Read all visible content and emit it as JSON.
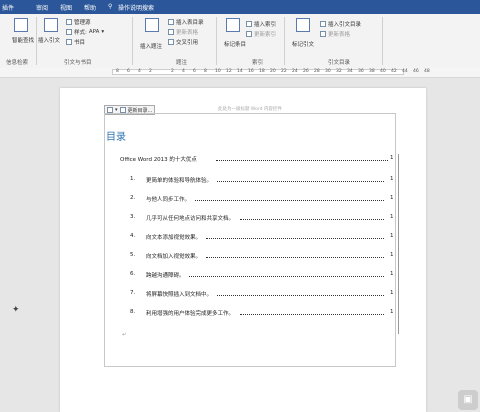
{
  "tabs": [
    "插件",
    "审阅",
    "视图",
    "帮助",
    "操作说明搜索"
  ],
  "ribbon": {
    "research": {
      "button": "智能查找",
      "label": "信息检索"
    },
    "citations": {
      "insert_citation": "插入引文",
      "manage_sources": "管理源",
      "style_label": "样式:",
      "style_value": "APA",
      "bibliography": "书目",
      "label": "引文与书目"
    },
    "captions": {
      "insert_caption": "插入题注",
      "insert_table_of_figures": "插入表目录",
      "update_table": "更新表格",
      "cross_reference": "交叉引用",
      "label": "题注"
    },
    "index": {
      "mark_entry": "标记条目",
      "insert_index": "插入索引",
      "update_index": "更新索引",
      "label": "索引"
    },
    "authorities": {
      "mark_citation": "标记引文",
      "insert_toa": "插入引文目录",
      "update_table": "更新表格",
      "label": "引文目录"
    }
  },
  "ruler_numbers": [
    "8",
    "6",
    "4",
    "2",
    "",
    "2",
    "4",
    "6",
    "8",
    "10",
    "12",
    "14",
    "16",
    "18",
    "20",
    "22",
    "24",
    "26",
    "28",
    "30",
    "32",
    "34",
    "36",
    "38",
    "40",
    "42",
    "44",
    "46",
    "48"
  ],
  "document": {
    "cc_tab_label": "更新目录...",
    "header_note": "此处为一级标题 Word 内容控件",
    "toc_title": "目录",
    "toc_heading": {
      "text": "Office Word 2013 的十大优点",
      "page": "1"
    },
    "toc_items": [
      {
        "num": "1.",
        "text": "更简单的体验和导航体验。",
        "page": "1"
      },
      {
        "num": "2.",
        "text": "与他人同步工作。",
        "page": "1"
      },
      {
        "num": "3.",
        "text": "几乎可从任何地点访问和共享文档。",
        "page": "1"
      },
      {
        "num": "4.",
        "text": "向文本添加视觉效果。",
        "page": "1"
      },
      {
        "num": "5.",
        "text": "向文档加入视觉效果。",
        "page": "1"
      },
      {
        "num": "6.",
        "text": "跨越沟通障碍。",
        "page": "1"
      },
      {
        "num": "7.",
        "text": "将屏幕快照插入到文档中。",
        "page": "1"
      },
      {
        "num": "8.",
        "text": "利用增强的用户体验完成更多工作。",
        "page": "1"
      }
    ]
  }
}
